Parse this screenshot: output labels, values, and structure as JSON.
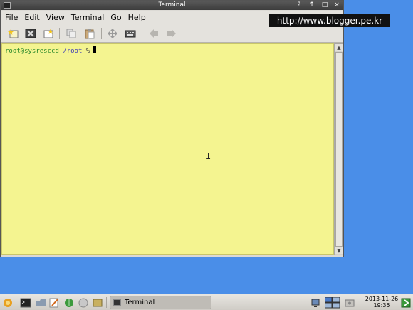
{
  "window": {
    "title": "Terminal",
    "controls": {
      "help": "?",
      "minimize": "↑",
      "maximize": "□",
      "close": "×"
    }
  },
  "menu": [
    {
      "label": "File",
      "mnemonic": "F",
      "rest": "ile"
    },
    {
      "label": "Edit",
      "mnemonic": "E",
      "rest": "dit"
    },
    {
      "label": "View",
      "mnemonic": "V",
      "rest": "iew"
    },
    {
      "label": "Terminal",
      "mnemonic": "T",
      "rest": "erminal"
    },
    {
      "label": "Go",
      "mnemonic": "G",
      "rest": "o"
    },
    {
      "label": "Help",
      "mnemonic": "H",
      "rest": "elp"
    }
  ],
  "toolbar": {
    "icons": [
      "new-tab-icon",
      "close-tab-icon",
      "new-window-icon",
      "copy-icon",
      "paste-icon",
      "move-icon",
      "keyboard-icon",
      "back-arrow-icon",
      "forward-arrow-icon"
    ]
  },
  "terminal": {
    "user_host": "root@sysresccd",
    "path": "/root",
    "prompt_symbol": "%"
  },
  "watermark": "http://www.blogger.pe.kr",
  "taskbar": {
    "task_label": "Terminal",
    "date": "2013-11-26",
    "time": "19:35"
  },
  "colors": {
    "desktop": "#4a8ee8",
    "terminal_bg": "#f4f490",
    "prompt_user": "#2c8a2c",
    "prompt_path": "#3b3bb8"
  }
}
